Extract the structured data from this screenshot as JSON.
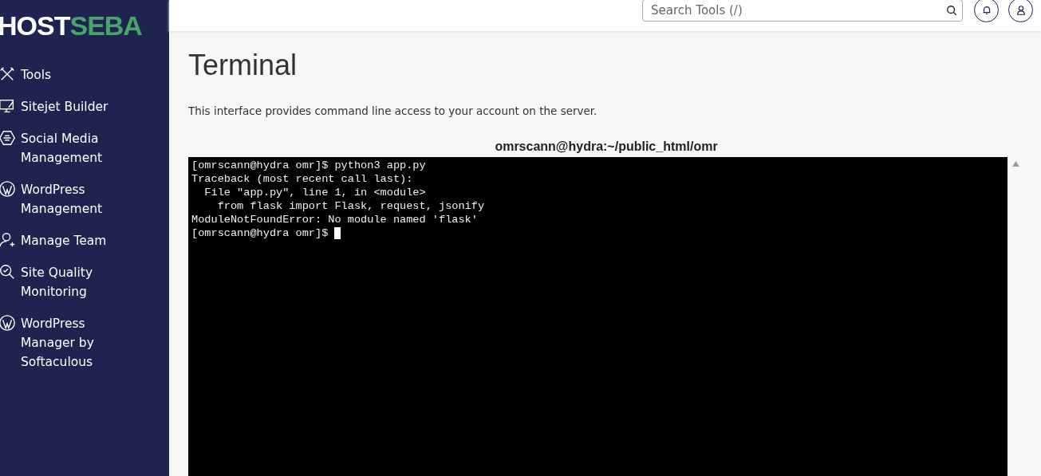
{
  "logo": {
    "part_1": "HOST",
    "part_2": "SEBA"
  },
  "sidebar": {
    "items": [
      {
        "label": "Tools",
        "kind": "tools"
      },
      {
        "label": "Sitejet Builder",
        "kind": "sitejet"
      },
      {
        "label": "Social Media Management",
        "kind": "social"
      },
      {
        "label": "WordPress Management",
        "kind": "wordpress"
      },
      {
        "label": "Manage Team",
        "kind": "team"
      },
      {
        "label": "Site Quality Monitoring",
        "kind": "quality"
      },
      {
        "label": "WordPress Manager by Softaculous",
        "kind": "wordpress"
      }
    ]
  },
  "header": {
    "search": {
      "placeholder": "Search Tools (/)"
    }
  },
  "page": {
    "title": "Terminal",
    "description": "This interface provides command line access to your account on the server."
  },
  "terminal": {
    "title": "omrscann@hydra:~/public_html/omr",
    "lines": [
      "[omrscann@hydra omr]$ python3 app.py",
      "Traceback (most recent call last):",
      "  File \"app.py\", line 1, in <module>",
      "    from flask import Flask, request, jsonify",
      "ModuleNotFoundError: No module named 'flask'"
    ],
    "prompt": "[omrscann@hydra omr]$ "
  }
}
